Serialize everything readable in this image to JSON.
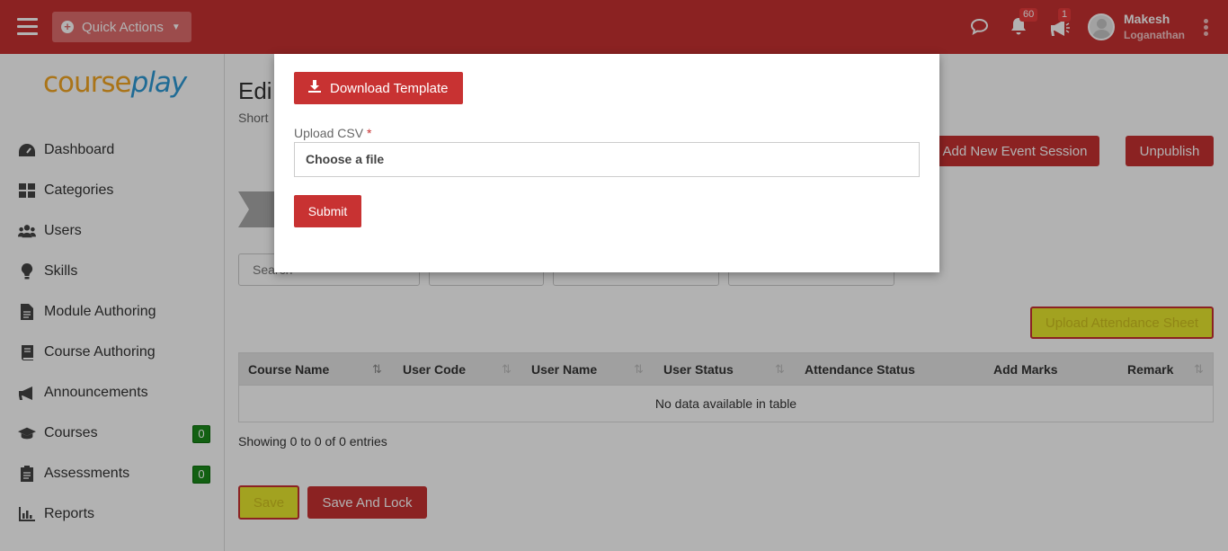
{
  "topbar": {
    "quick_actions_label": "Quick Actions",
    "notifications_count": "60",
    "announcements_count": "1",
    "user_first": "Makesh",
    "user_last": "Loganathan"
  },
  "logo": {
    "part1": "course",
    "part2": "play"
  },
  "sidebar": {
    "items": [
      {
        "label": "Dashboard",
        "icon": "dashboard-icon"
      },
      {
        "label": "Categories",
        "icon": "grid-icon"
      },
      {
        "label": "Users",
        "icon": "users-icon"
      },
      {
        "label": "Skills",
        "icon": "lightbulb-icon"
      },
      {
        "label": "Module Authoring",
        "icon": "file-icon"
      },
      {
        "label": "Course Authoring",
        "icon": "book-icon"
      },
      {
        "label": "Announcements",
        "icon": "bullhorn-icon"
      },
      {
        "label": "Courses",
        "icon": "graduation-cap-icon",
        "count": "0"
      },
      {
        "label": "Assessments",
        "icon": "clipboard-icon",
        "count": "0"
      },
      {
        "label": "Reports",
        "icon": "bar-chart-icon"
      }
    ]
  },
  "main": {
    "title": "Edi",
    "subtitle": "Short",
    "add_session_label": "Add New Event Session",
    "unpublish_label": "Unpublish",
    "search_placeholder": "Search",
    "upload_attendance_label": "Upload Attendance Sheet",
    "table": {
      "columns": [
        "Course Name",
        "User Code",
        "User Name",
        "User Status",
        "Attendance Status",
        "Add Marks",
        "Remark"
      ],
      "empty_text": "No data available in table"
    },
    "showing_text": "Showing 0 to 0 of 0 entries",
    "save_label": "Save",
    "save_lock_label": "Save And Lock"
  },
  "modal": {
    "download_label": "Download Template",
    "upload_label": "Upload CSV",
    "required_mark": "*",
    "file_placeholder": "Choose a file",
    "submit_label": "Submit"
  },
  "colors": {
    "brand": "#c83232",
    "highlight": "#e8e82e",
    "success": "#1a8a1a"
  }
}
